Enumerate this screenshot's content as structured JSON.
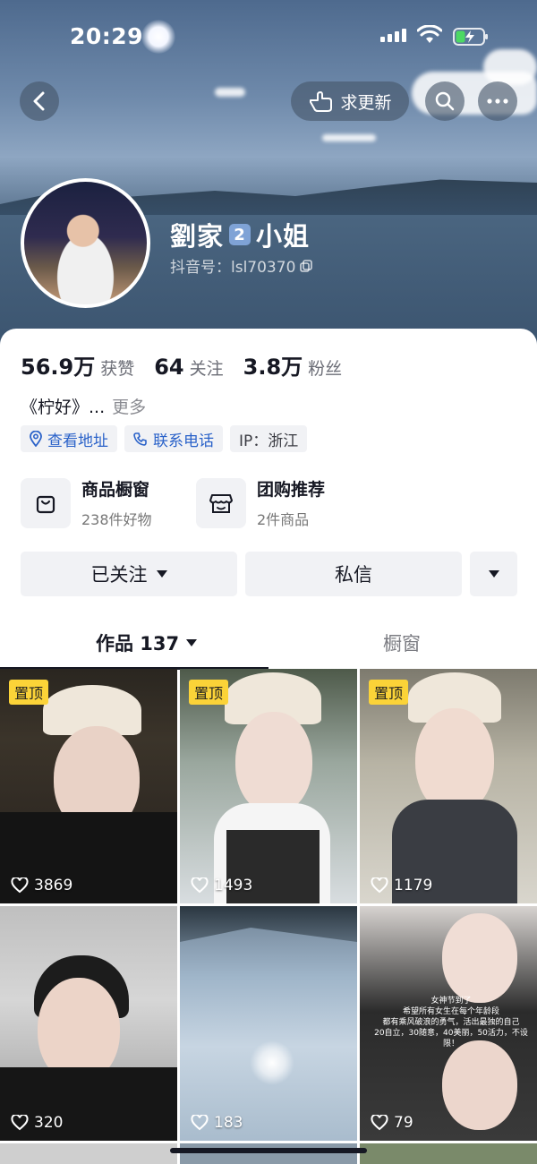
{
  "status": {
    "time": "20:29"
  },
  "topbar": {
    "update_label": "求更新"
  },
  "profile": {
    "name_part1": "劉家",
    "level_badge": "2",
    "name_part2": "小姐",
    "douyin_id": "抖音号：lsl70370"
  },
  "stats": [
    {
      "value": "56.9万",
      "label": "获赞"
    },
    {
      "value": "64",
      "label": "关注"
    },
    {
      "value": "3.8万",
      "label": "粉丝"
    }
  ],
  "bio": {
    "text": "《柠好》...",
    "more": "更多"
  },
  "chips": {
    "address": "查看地址",
    "phone": "联系电话",
    "ip": "IP：浙江"
  },
  "features": [
    {
      "title": "商品橱窗",
      "sub": "238件好物",
      "icon": "shopping-bag-icon"
    },
    {
      "title": "团购推荐",
      "sub": "2件商品",
      "icon": "storefront-icon"
    }
  ],
  "actions": {
    "follow": "已关注",
    "message": "私信"
  },
  "tabs": {
    "works": "作品 137",
    "showcase": "橱窗"
  },
  "videos": [
    {
      "pinned": "置顶",
      "likes": "3869"
    },
    {
      "pinned": "置顶",
      "likes": "1493"
    },
    {
      "pinned": "置顶",
      "likes": "1179"
    },
    {
      "pinned": "",
      "likes": "320"
    },
    {
      "pinned": "",
      "likes": "183"
    },
    {
      "pinned": "",
      "likes": "79"
    }
  ],
  "overlay_text": {
    "line1": "女神节到了",
    "line2": "希望所有女生在每个年龄段",
    "line3": "都有乘风破浪的勇气，活出最独的自己",
    "line4": "20自立，30随意，40美丽，50活力，不设限！"
  }
}
